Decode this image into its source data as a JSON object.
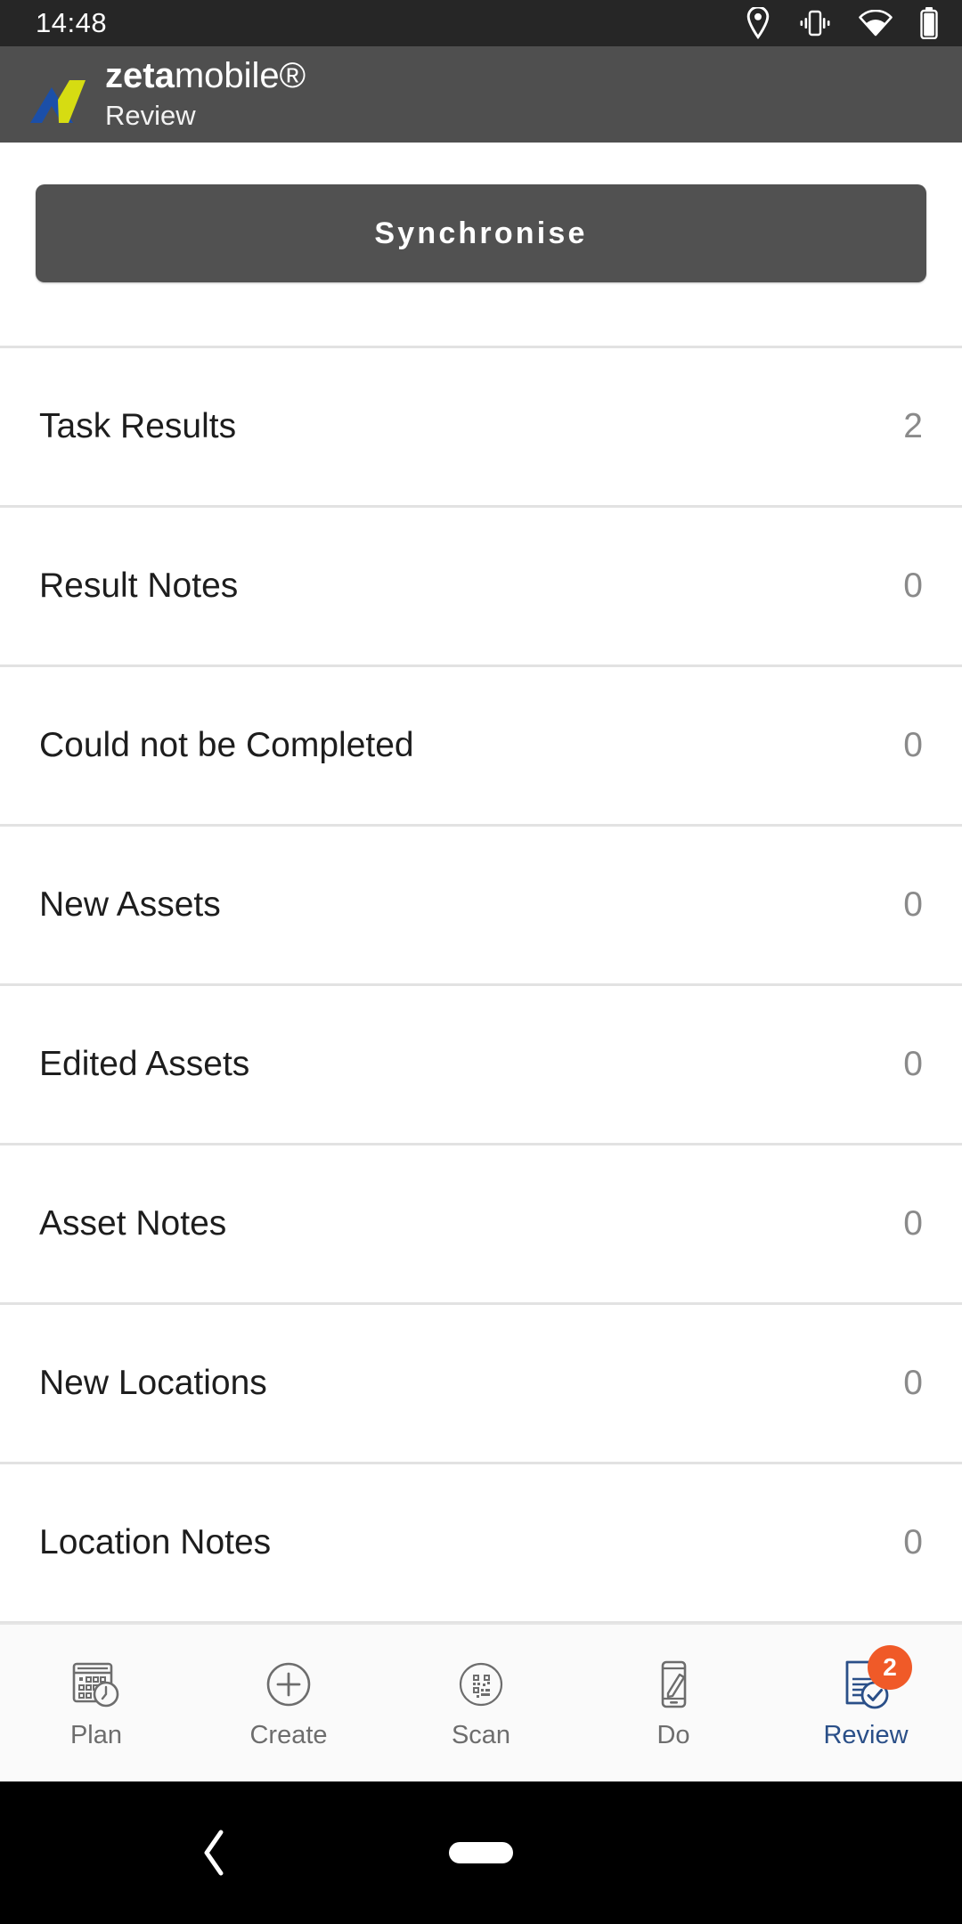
{
  "statusbar": {
    "time": "14:48",
    "icons": [
      "location-pin-icon",
      "vibrate-icon",
      "wifi-icon",
      "battery-icon"
    ]
  },
  "header": {
    "logo": "zeta-mobile-logo",
    "brand_bold": "zeta",
    "brand_light": "mobile",
    "brand_mark": "®",
    "subtitle": "Review",
    "background": "#4f4f4f"
  },
  "toolbar": {
    "sync_label": "Synchronise",
    "sync_background": "#515151"
  },
  "list": {
    "rows": [
      {
        "label": "Task Results",
        "value": "2"
      },
      {
        "label": "Result Notes",
        "value": "0"
      },
      {
        "label": "Could not be Completed",
        "value": "0"
      },
      {
        "label": "New Assets",
        "value": "0"
      },
      {
        "label": "Edited Assets",
        "value": "0"
      },
      {
        "label": "Asset Notes",
        "value": "0"
      },
      {
        "label": "New Locations",
        "value": "0"
      },
      {
        "label": "Location Notes",
        "value": "0"
      }
    ]
  },
  "tabbar": {
    "active_color": "#2a4f88",
    "inactive_color": "#6d6d6d",
    "badge_color": "#f05a28",
    "tabs": [
      {
        "label": "Plan",
        "icon": "calendar-clock-icon",
        "active": false,
        "badge": ""
      },
      {
        "label": "Create",
        "icon": "plus-circle-icon",
        "active": false,
        "badge": ""
      },
      {
        "label": "Scan",
        "icon": "qr-code-icon",
        "active": false,
        "badge": ""
      },
      {
        "label": "Do",
        "icon": "phone-pencil-icon",
        "active": false,
        "badge": ""
      },
      {
        "label": "Review",
        "icon": "document-check-icon",
        "active": true,
        "badge": "2"
      }
    ]
  },
  "sysnav": {
    "back": "back-chevron-icon",
    "home": "home-pill-icon"
  }
}
